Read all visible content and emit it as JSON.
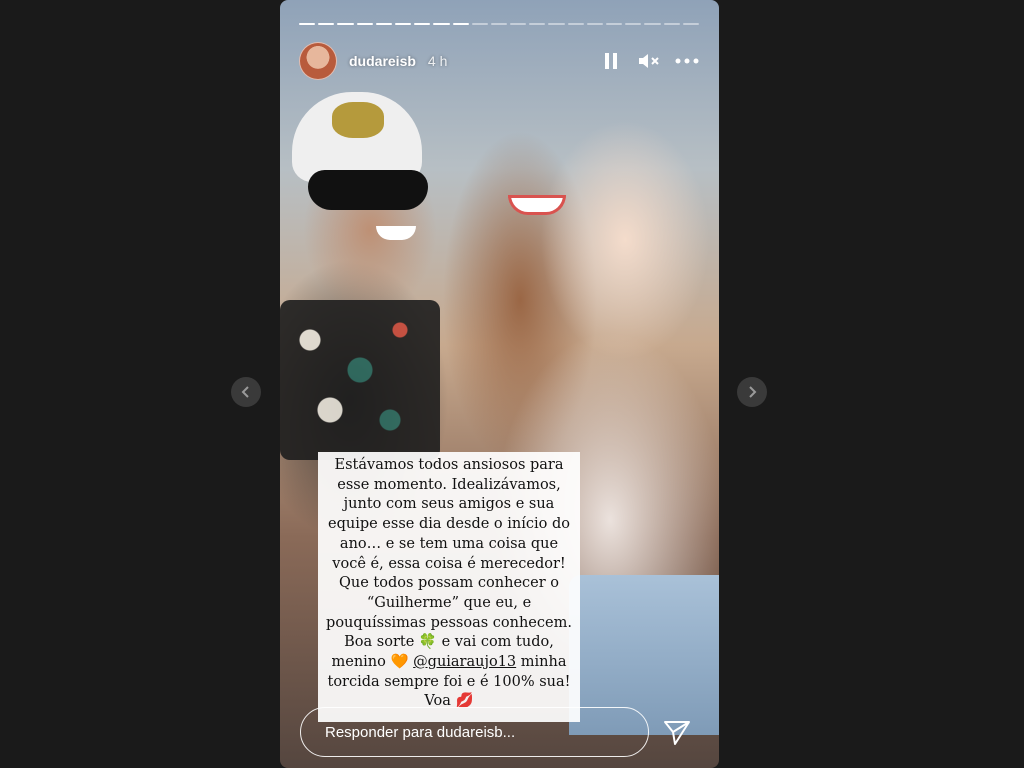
{
  "story": {
    "username": "dudareisb",
    "time_ago": "4 h",
    "progress": {
      "total_segments": 21,
      "completed_segments": 9
    }
  },
  "icons": {
    "pause": "pause-icon",
    "mute": "speaker-muted-icon",
    "more": "more-horizontal-icon",
    "send": "send-icon",
    "prev": "chevron-left-icon",
    "next": "chevron-right-icon"
  },
  "caption": {
    "text_before_mention": "Estávamos todos ansiosos para esse momento. Idealizávamos, junto com seus amigos e sua equipe esse dia desde o início do ano… e se tem uma coisa que você é, essa coisa é merecedor! Que todos possam conhecer o “Guilherme” que eu, e pouquíssimas pessoas conhecem. Boa sorte 🍀 e vai com tudo, menino 🧡 ",
    "mention": "@guiaraujo13",
    "text_after_mention": " minha torcida sempre foi e é 100% sua! Voa 💋"
  },
  "reply": {
    "placeholder": "Responder para dudareisb..."
  },
  "colors": {
    "page_background": "#1a1a1a",
    "nav_button": "#3a3a3a",
    "caption_background": "#ffffff"
  }
}
